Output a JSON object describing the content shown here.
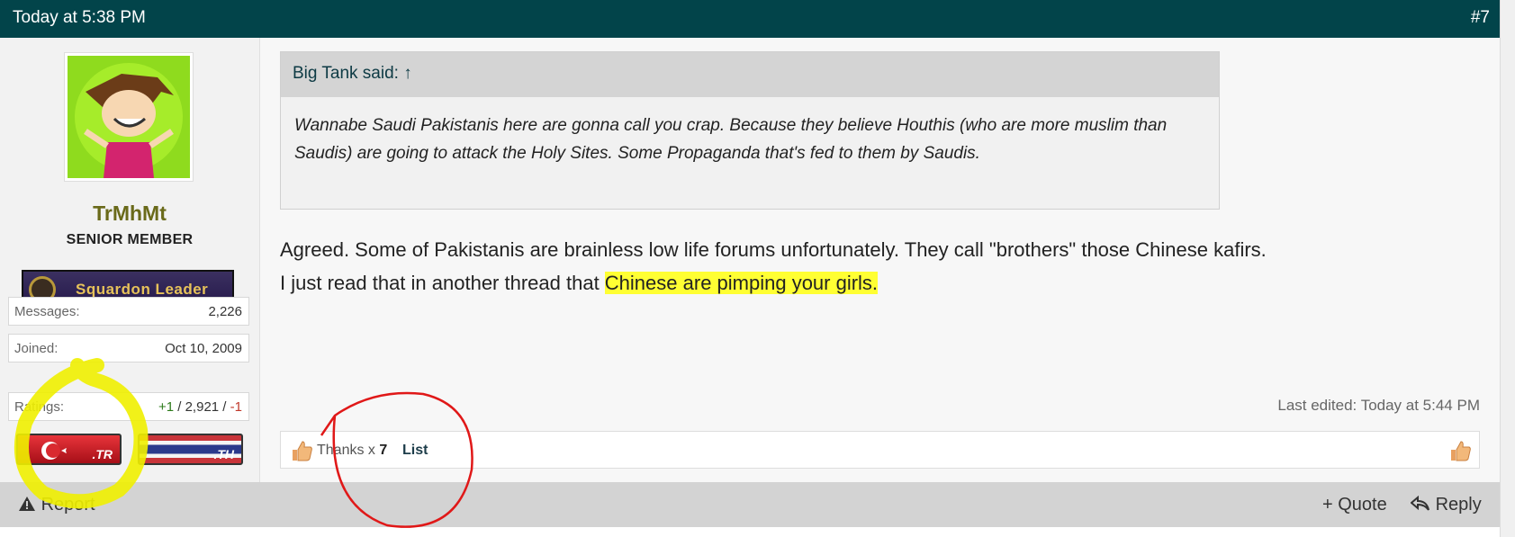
{
  "header": {
    "date": "Today at 5:38 PM",
    "post_number": "#7"
  },
  "user": {
    "name": "TrMhMt",
    "title": "SENIOR MEMBER",
    "rank": "Squardon Leader",
    "stats": {
      "messages_label": "Messages:",
      "messages_value": "2,226",
      "joined_label": "Joined:",
      "joined_value": "Oct 10, 2009",
      "ratings_label": "Ratings:",
      "ratings_pos": "+1",
      "ratings_sep1": " / ",
      "ratings_mid": "2,921",
      "ratings_sep2": " / ",
      "ratings_neg": "-1"
    },
    "flags": [
      ".TR",
      ".TH"
    ]
  },
  "post": {
    "quote_author": "Big Tank said: ↑",
    "quote_text": "Wannabe Saudi Pakistanis here are gonna call you crap. Because they believe Houthis (who are more muslim than Saudis) are going to attack the Holy Sites. Some Propaganda that's fed to them by Saudis.",
    "line1": "Agreed. Some of Pakistanis are brainless low life forums unfortunately. They call \"brothers\" those Chinese kafirs.",
    "line2_plain": "I just read that in another thread that ",
    "line2_highlight": "Chinese are pimping your girls.",
    "last_edited": "Last edited: Today at 5:44 PM"
  },
  "reactions": {
    "thanks_text": "Thanks x ",
    "thanks_count": "7",
    "list_label": "List"
  },
  "footer": {
    "report": "Report",
    "quote": "+ Quote",
    "reply": "Reply"
  }
}
